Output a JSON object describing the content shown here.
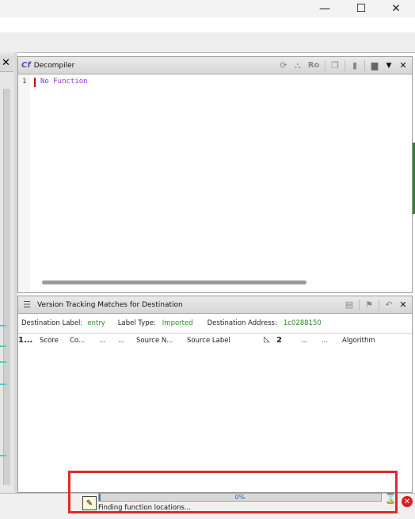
{
  "window": {
    "minimize_glyph": "—",
    "maximize_glyph": "☐",
    "close_glyph": "✕"
  },
  "left_panel": {
    "close_glyph": "✕"
  },
  "decompiler": {
    "title": "Decompiler",
    "icon_label": "Cf",
    "toolbar_icons": [
      "refresh-icon",
      "graph-icon",
      "ro-icon",
      "copy-icon",
      "delete-icon",
      "snapshot-icon",
      "menu-icon"
    ],
    "ro_label": "Ro",
    "close_glyph": "✕",
    "line_number": "1",
    "code_line": "No Function"
  },
  "vt_matches": {
    "title": "Version Tracking Matches for Destination",
    "close_glyph": "✕",
    "destination_label_caption": "Destination Label:",
    "destination_label_value": "entry",
    "label_type_caption": "Label Type:",
    "label_type_value": "Imported",
    "destination_address_caption": "Destination Address:",
    "destination_address_value": "1c0288150",
    "columns": {
      "c1": "1...",
      "c2": "Score",
      "c3": "Co...",
      "c4": "...",
      "c5": "...",
      "c6": "Source N...",
      "c7": "Source Label",
      "c8": "2",
      "c9": "...",
      "c10": "...",
      "c11": "Algorithm"
    }
  },
  "status_bar": {
    "progress_text": "0%",
    "progress_value": 0,
    "message": "Finding function locations..."
  },
  "colors": {
    "highlight_box": "#dd2b2b",
    "label_value": "#2e8b2e",
    "code_text": "#9a2fcf"
  }
}
